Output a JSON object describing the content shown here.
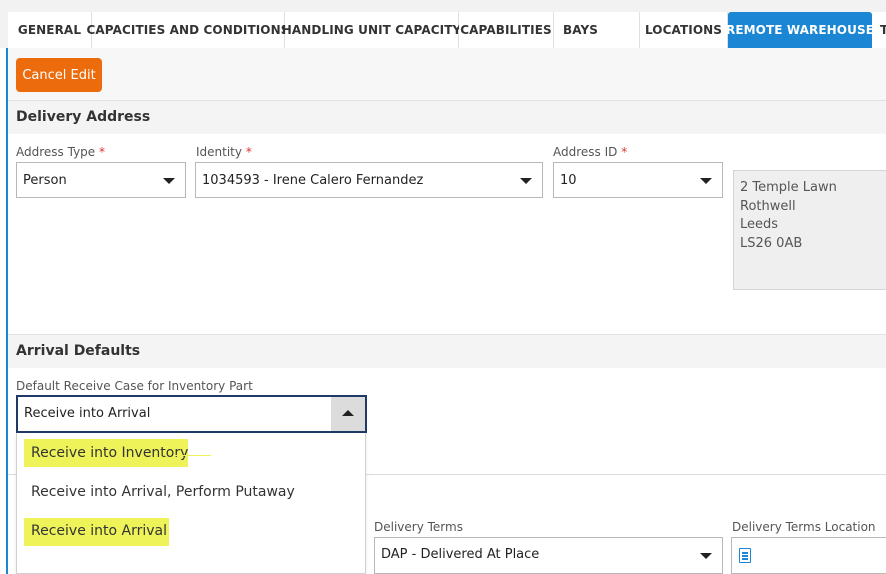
{
  "tabs": [
    {
      "label": "GENERAL",
      "active": false
    },
    {
      "label": "CAPACITIES AND CONDITIONS",
      "active": false
    },
    {
      "label": "HANDLING UNIT CAPACITY",
      "active": false
    },
    {
      "label": "CAPABILITIES",
      "active": false
    },
    {
      "label": "BAYS",
      "active": false
    },
    {
      "label": "LOCATIONS",
      "active": false
    },
    {
      "label": "REMOTE WAREHOUSE",
      "active": true
    },
    {
      "label": "T",
      "active": false
    }
  ],
  "toolbar": {
    "cancel_label": "Cancel Edit"
  },
  "delivery_address": {
    "title": "Delivery Address",
    "address_type": {
      "label": "Address Type",
      "required_mark": "*",
      "value": "Person"
    },
    "identity": {
      "label": "Identity",
      "required_mark": "*",
      "value": "1034593 - Irene Calero Fernandez"
    },
    "address_id": {
      "label": "Address ID",
      "required_mark": "*",
      "value": "10"
    },
    "address_lines": [
      "2 Temple Lawn",
      "Rothwell",
      "Leeds",
      "LS26 0AB"
    ]
  },
  "arrival_defaults": {
    "title": "Arrival Defaults",
    "receive_case": {
      "label": "Default Receive Case for Inventory Part",
      "value": "Receive into Arrival",
      "options": [
        {
          "label": "Receive into Inventory",
          "highlighted": true
        },
        {
          "label": "Receive into Arrival, Perform Putaway",
          "highlighted": false
        },
        {
          "label": "Receive into Arrival",
          "highlighted": true
        }
      ]
    }
  },
  "delivery_terms": {
    "label": "Delivery Terms",
    "value": "DAP - Delivered At Place",
    "location_label": "Delivery Terms Location"
  },
  "colors": {
    "accent": "#1a86d4",
    "cancel_button": "#ec6b0d",
    "highlight": "#eef35a",
    "required": "#e0342d"
  },
  "icons": [
    "chevron-down-icon",
    "chevron-up-icon",
    "document-icon"
  ]
}
